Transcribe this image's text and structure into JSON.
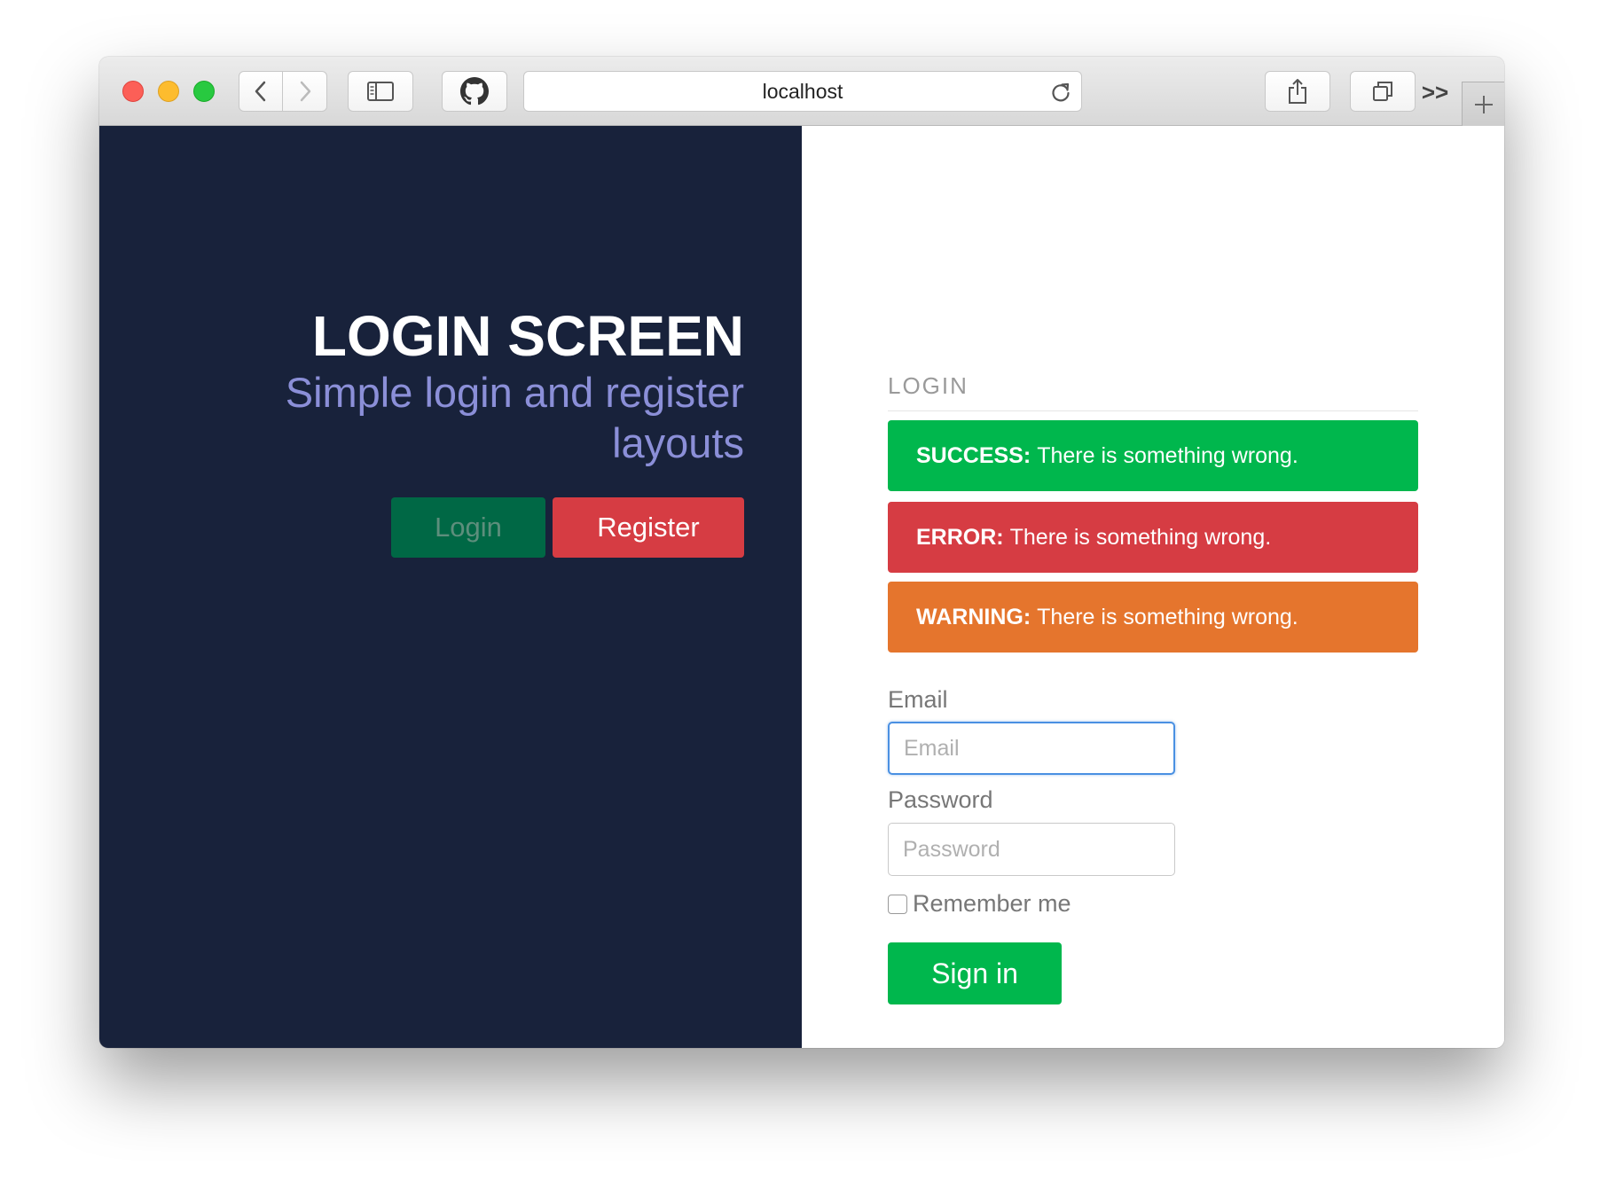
{
  "browser": {
    "url": "localhost",
    "icons": {
      "back": "chevron-left-icon",
      "forward": "chevron-right-icon",
      "sidebar": "sidebar-icon",
      "github": "github-icon",
      "reload": "reload-icon",
      "share": "share-icon",
      "tabs": "tabs-icon",
      "more": "double-chevron-icon",
      "new_tab": "plus-icon"
    },
    "more_label": ">>"
  },
  "hero": {
    "title": "LOGIN SCREEN",
    "subtitle": "Simple login and register layouts",
    "login_label": "Login",
    "register_label": "Register"
  },
  "form": {
    "heading": "LOGIN",
    "alerts": [
      {
        "type": "success",
        "label": "SUCCESS:",
        "message": "There is something wrong.",
        "color": "#00b74d"
      },
      {
        "type": "error",
        "label": "ERROR:",
        "message": "There is something wrong.",
        "color": "#d63c43"
      },
      {
        "type": "warning",
        "label": "WARNING:",
        "message": "There is something wrong.",
        "color": "#e5752d"
      }
    ],
    "email_label": "Email",
    "email_placeholder": "Email",
    "email_value": "",
    "password_label": "Password",
    "password_placeholder": "Password",
    "password_value": "",
    "remember_label": "Remember me",
    "remember_checked": false,
    "signin_label": "Sign in"
  },
  "colors": {
    "left_panel_bg": "#18223b",
    "accent_green": "#00b74d",
    "accent_red": "#d63c43",
    "subtitle": "#8b8fd8"
  }
}
